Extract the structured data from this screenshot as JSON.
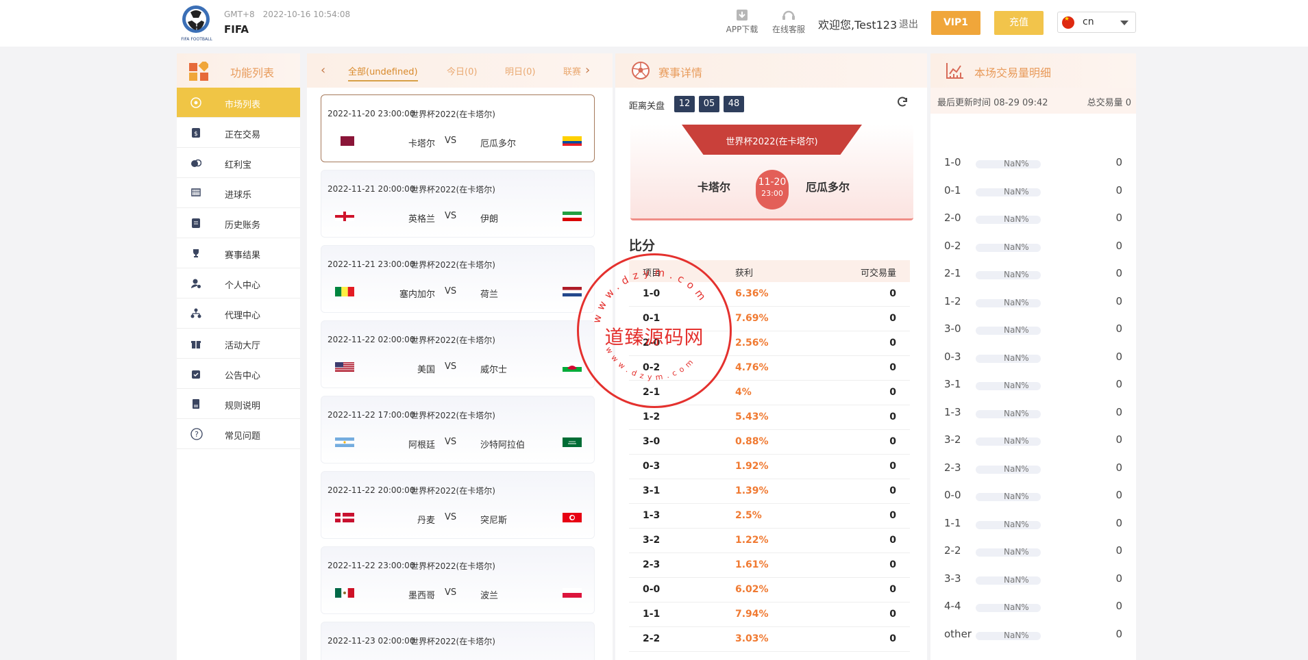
{
  "header": {
    "timezone": "GMT+8",
    "datetime": "2022-10-16 10:54:08",
    "title": "FIFA",
    "logo_text": "FIFA FOOTBALL",
    "app_download": "APP下载",
    "online_service": "在线客服",
    "welcome": "欢迎您,Test123",
    "logout": "退出",
    "vip": "VIP1",
    "recharge": "充值",
    "language": "cn"
  },
  "sidebar": {
    "title": "功能列表",
    "items": [
      {
        "label": "市场列表",
        "icon": "soccer-ball-icon"
      },
      {
        "label": "正在交易",
        "icon": "dollar-doc-icon"
      },
      {
        "label": "红利宝",
        "icon": "coins-icon"
      },
      {
        "label": "进球乐",
        "icon": "goal-icon"
      },
      {
        "label": "历史账务",
        "icon": "ledger-icon"
      },
      {
        "label": "赛事结果",
        "icon": "trophy-icon"
      },
      {
        "label": "个人中心",
        "icon": "user-gear-icon"
      },
      {
        "label": "代理中心",
        "icon": "org-chart-icon"
      },
      {
        "label": "活动大厅",
        "icon": "gift-icon"
      },
      {
        "label": "公告中心",
        "icon": "calendar-check-icon"
      },
      {
        "label": "规则说明",
        "icon": "rules-book-icon"
      },
      {
        "label": "常见问题",
        "icon": "question-icon"
      }
    ]
  },
  "tabs": [
    "全部(undefined)",
    "今日(0)",
    "明日(0)",
    "联赛"
  ],
  "matches": [
    {
      "time": "2022-11-20 23:00:00",
      "league": "世界杯2022(在卡塔尔)",
      "home": "卡塔尔",
      "vs": "VS",
      "away": "厄瓜多尔",
      "home_flag": "qatar-flag-icon",
      "away_flag": "ecuador-flag-icon"
    },
    {
      "time": "2022-11-21 20:00:00",
      "league": "世界杯2022(在卡塔尔)",
      "home": "英格兰",
      "vs": "VS",
      "away": "伊朗",
      "home_flag": "england-flag-icon",
      "away_flag": "iran-flag-icon"
    },
    {
      "time": "2022-11-21 23:00:00",
      "league": "世界杯2022(在卡塔尔)",
      "home": "塞内加尔",
      "vs": "VS",
      "away": "荷兰",
      "home_flag": "senegal-flag-icon",
      "away_flag": "netherlands-flag-icon"
    },
    {
      "time": "2022-11-22 02:00:00",
      "league": "世界杯2022(在卡塔尔)",
      "home": "美国",
      "vs": "VS",
      "away": "威尔士",
      "home_flag": "usa-flag-icon",
      "away_flag": "wales-flag-icon"
    },
    {
      "time": "2022-11-22 17:00:00",
      "league": "世界杯2022(在卡塔尔)",
      "home": "阿根廷",
      "vs": "VS",
      "away": "沙特阿拉伯",
      "home_flag": "argentina-flag-icon",
      "away_flag": "saudi-flag-icon"
    },
    {
      "time": "2022-11-22 20:00:00",
      "league": "世界杯2022(在卡塔尔)",
      "home": "丹麦",
      "vs": "VS",
      "away": "突尼斯",
      "home_flag": "denmark-flag-icon",
      "away_flag": "tunisia-flag-icon"
    },
    {
      "time": "2022-11-22 23:00:00",
      "league": "世界杯2022(在卡塔尔)",
      "home": "墨西哥",
      "vs": "VS",
      "away": "波兰",
      "home_flag": "mexico-flag-icon",
      "away_flag": "poland-flag-icon"
    },
    {
      "time": "2022-11-23 02:00:00",
      "league": "世界杯2022(在卡塔尔)",
      "home": "",
      "vs": "",
      "away": "",
      "home_flag": "",
      "away_flag": ""
    }
  ],
  "detail": {
    "title": "赛事详情",
    "countdown_label": "距离关盘",
    "countdown": [
      "12",
      "05",
      "48"
    ],
    "banner": {
      "league": "世界杯2022(在卡塔尔)",
      "home": "卡塔尔",
      "away": "厄瓜多尔",
      "date": "11-20",
      "hour": "23:00"
    },
    "score_title": "比分",
    "columns": [
      "项目",
      "获利",
      "可交易量"
    ],
    "rows": [
      {
        "score": "1-0",
        "profit": "6.36%",
        "volume": "0"
      },
      {
        "score": "0-1",
        "profit": "7.69%",
        "volume": "0"
      },
      {
        "score": "2-0",
        "profit": "2.56%",
        "volume": "0"
      },
      {
        "score": "0-2",
        "profit": "4.76%",
        "volume": "0"
      },
      {
        "score": "2-1",
        "profit": "4%",
        "volume": "0"
      },
      {
        "score": "1-2",
        "profit": "5.43%",
        "volume": "0"
      },
      {
        "score": "3-0",
        "profit": "0.88%",
        "volume": "0"
      },
      {
        "score": "0-3",
        "profit": "1.92%",
        "volume": "0"
      },
      {
        "score": "3-1",
        "profit": "1.39%",
        "volume": "0"
      },
      {
        "score": "1-3",
        "profit": "2.5%",
        "volume": "0"
      },
      {
        "score": "3-2",
        "profit": "1.22%",
        "volume": "0"
      },
      {
        "score": "2-3",
        "profit": "1.61%",
        "volume": "0"
      },
      {
        "score": "0-0",
        "profit": "6.02%",
        "volume": "0"
      },
      {
        "score": "1-1",
        "profit": "7.94%",
        "volume": "0"
      },
      {
        "score": "2-2",
        "profit": "3.03%",
        "volume": "0"
      }
    ]
  },
  "volume": {
    "title": "本场交易量明细",
    "updated": "最后更新时间 08-29 09:42",
    "total": "总交易量 0",
    "rows": [
      {
        "score": "1-0",
        "pct": "NaN%",
        "value": "0"
      },
      {
        "score": "0-1",
        "pct": "NaN%",
        "value": "0"
      },
      {
        "score": "2-0",
        "pct": "NaN%",
        "value": "0"
      },
      {
        "score": "0-2",
        "pct": "NaN%",
        "value": "0"
      },
      {
        "score": "2-1",
        "pct": "NaN%",
        "value": "0"
      },
      {
        "score": "1-2",
        "pct": "NaN%",
        "value": "0"
      },
      {
        "score": "3-0",
        "pct": "NaN%",
        "value": "0"
      },
      {
        "score": "0-3",
        "pct": "NaN%",
        "value": "0"
      },
      {
        "score": "3-1",
        "pct": "NaN%",
        "value": "0"
      },
      {
        "score": "1-3",
        "pct": "NaN%",
        "value": "0"
      },
      {
        "score": "3-2",
        "pct": "NaN%",
        "value": "0"
      },
      {
        "score": "2-3",
        "pct": "NaN%",
        "value": "0"
      },
      {
        "score": "0-0",
        "pct": "NaN%",
        "value": "0"
      },
      {
        "score": "1-1",
        "pct": "NaN%",
        "value": "0"
      },
      {
        "score": "2-2",
        "pct": "NaN%",
        "value": "0"
      },
      {
        "score": "3-3",
        "pct": "NaN%",
        "value": "0"
      },
      {
        "score": "4-4",
        "pct": "NaN%",
        "value": "0"
      },
      {
        "score": "other",
        "pct": "NaN%",
        "value": "0"
      }
    ]
  },
  "watermark": {
    "main": "道臻源码网",
    "ring": "www.dzym.com"
  },
  "colors": {
    "accent": "#f0c545",
    "vip": "#f0a63a",
    "profit": "#f07a32",
    "stamp": "#e4312e",
    "countdown": "#2e3e5c"
  }
}
